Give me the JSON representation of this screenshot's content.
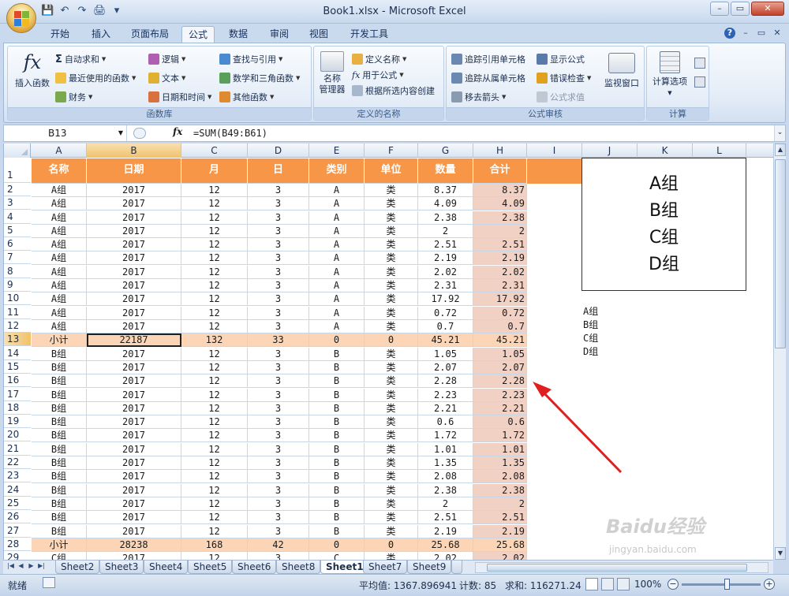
{
  "window": {
    "title": "Book1.xlsx - Microsoft Excel",
    "min": "–",
    "restore": "▭",
    "close": "✕"
  },
  "qat": [
    "💾",
    "↶",
    "↷",
    "🖨",
    "▾"
  ],
  "tabs": [
    "开始",
    "插入",
    "页面布局",
    "公式",
    "数据",
    "审阅",
    "视图",
    "开发工具"
  ],
  "active_tab": "公式",
  "ribbon": {
    "function_library": {
      "label": "函数库",
      "insert_function": "插入函数",
      "autosum": "自动求和",
      "recent": "最近使用的函数",
      "financial": "财务",
      "logical": "逻辑",
      "text": "文本",
      "datetime": "日期和时间",
      "lookup": "查找与引用",
      "math": "数学和三角函数",
      "more": "其他函数"
    },
    "defined_names": {
      "label": "定义的名称",
      "name_manager_1": "名称",
      "name_manager_2": "管理器",
      "define_name": "定义名称",
      "use_in_formula": "用于公式",
      "create_from_selection": "根据所选内容创建"
    },
    "formula_auditing": {
      "label": "公式审核",
      "trace_precedents": "追踪引用单元格",
      "trace_dependents": "追踪从属单元格",
      "remove_arrows": "移去箭头",
      "show_formulas": "显示公式",
      "error_checking": "错误检查",
      "evaluate_formula": "公式求值",
      "watch_window": "监视窗口"
    },
    "calculation": {
      "label": "计算",
      "options": "计算选项"
    }
  },
  "formula_bar": {
    "name_box": "B13",
    "formula": "=SUM(B49:B61)",
    "fx": "fx"
  },
  "columns": [
    "A",
    "B",
    "C",
    "D",
    "E",
    "F",
    "G",
    "H",
    "I",
    "J",
    "K",
    "L"
  ],
  "header": [
    "名称",
    "日期",
    "月",
    "日",
    "类别",
    "单位",
    "数量",
    "合计"
  ],
  "rows": [
    {
      "n": "2",
      "c": [
        "A组",
        "2017",
        "12",
        "3",
        "A",
        "类",
        "8.37",
        "8.37"
      ]
    },
    {
      "n": "3",
      "c": [
        "A组",
        "2017",
        "12",
        "3",
        "A",
        "类",
        "4.09",
        "4.09"
      ]
    },
    {
      "n": "4",
      "c": [
        "A组",
        "2017",
        "12",
        "3",
        "A",
        "类",
        "2.38",
        "2.38"
      ]
    },
    {
      "n": "5",
      "c": [
        "A组",
        "2017",
        "12",
        "3",
        "A",
        "类",
        "2",
        "2"
      ]
    },
    {
      "n": "6",
      "c": [
        "A组",
        "2017",
        "12",
        "3",
        "A",
        "类",
        "2.51",
        "2.51"
      ]
    },
    {
      "n": "7",
      "c": [
        "A组",
        "2017",
        "12",
        "3",
        "A",
        "类",
        "2.19",
        "2.19"
      ]
    },
    {
      "n": "8",
      "c": [
        "A组",
        "2017",
        "12",
        "3",
        "A",
        "类",
        "2.02",
        "2.02"
      ]
    },
    {
      "n": "9",
      "c": [
        "A组",
        "2017",
        "12",
        "3",
        "A",
        "类",
        "2.31",
        "2.31"
      ]
    },
    {
      "n": "10",
      "c": [
        "A组",
        "2017",
        "12",
        "3",
        "A",
        "类",
        "17.92",
        "17.92"
      ]
    },
    {
      "n": "11",
      "c": [
        "A组",
        "2017",
        "12",
        "3",
        "A",
        "类",
        "0.72",
        "0.72"
      ]
    },
    {
      "n": "12",
      "c": [
        "A组",
        "2017",
        "12",
        "3",
        "A",
        "类",
        "0.7",
        "0.7"
      ]
    },
    {
      "n": "13",
      "c": [
        "小计",
        "22187",
        "132",
        "33",
        "0",
        "0",
        "45.21",
        "45.21"
      ],
      "sub": true
    },
    {
      "n": "14",
      "c": [
        "B组",
        "2017",
        "12",
        "3",
        "B",
        "类",
        "1.05",
        "1.05"
      ]
    },
    {
      "n": "15",
      "c": [
        "B组",
        "2017",
        "12",
        "3",
        "B",
        "类",
        "2.07",
        "2.07"
      ]
    },
    {
      "n": "16",
      "c": [
        "B组",
        "2017",
        "12",
        "3",
        "B",
        "类",
        "2.28",
        "2.28"
      ]
    },
    {
      "n": "17",
      "c": [
        "B组",
        "2017",
        "12",
        "3",
        "B",
        "类",
        "2.23",
        "2.23"
      ]
    },
    {
      "n": "18",
      "c": [
        "B组",
        "2017",
        "12",
        "3",
        "B",
        "类",
        "2.21",
        "2.21"
      ]
    },
    {
      "n": "19",
      "c": [
        "B组",
        "2017",
        "12",
        "3",
        "B",
        "类",
        "0.6",
        "0.6"
      ]
    },
    {
      "n": "20",
      "c": [
        "B组",
        "2017",
        "12",
        "3",
        "B",
        "类",
        "1.72",
        "1.72"
      ]
    },
    {
      "n": "21",
      "c": [
        "B组",
        "2017",
        "12",
        "3",
        "B",
        "类",
        "1.01",
        "1.01"
      ]
    },
    {
      "n": "22",
      "c": [
        "B组",
        "2017",
        "12",
        "3",
        "B",
        "类",
        "1.35",
        "1.35"
      ]
    },
    {
      "n": "23",
      "c": [
        "B组",
        "2017",
        "12",
        "3",
        "B",
        "类",
        "2.08",
        "2.08"
      ]
    },
    {
      "n": "24",
      "c": [
        "B组",
        "2017",
        "12",
        "3",
        "B",
        "类",
        "2.38",
        "2.38"
      ]
    },
    {
      "n": "25",
      "c": [
        "B组",
        "2017",
        "12",
        "3",
        "B",
        "类",
        "2",
        "2"
      ]
    },
    {
      "n": "26",
      "c": [
        "B组",
        "2017",
        "12",
        "3",
        "B",
        "类",
        "2.51",
        "2.51"
      ]
    },
    {
      "n": "27",
      "c": [
        "B组",
        "2017",
        "12",
        "3",
        "B",
        "类",
        "2.19",
        "2.19"
      ]
    },
    {
      "n": "28",
      "c": [
        "小计",
        "28238",
        "168",
        "42",
        "0",
        "0",
        "25.68",
        "25.68"
      ],
      "sub": true
    },
    {
      "n": "29",
      "c": [
        "C组",
        "2017",
        "12",
        "3",
        "C",
        "类",
        "2.02",
        "2.02"
      ]
    }
  ],
  "legend_box": [
    "A组",
    "B组",
    "C组",
    "D组"
  ],
  "small_list": [
    "A组",
    "B组",
    "C组",
    "D组"
  ],
  "sheet_tabs": [
    "Sheet2",
    "Sheet3",
    "Sheet4",
    "Sheet5",
    "Sheet6",
    "Sheet8",
    "Sheet1",
    "Sheet7",
    "Sheet9"
  ],
  "active_sheet": "Sheet1",
  "status": {
    "ready": "就绪",
    "average": "平均值: 1367.896941",
    "count": "计数: 85",
    "sum": "求和: 116271.24",
    "zoom": "100%"
  },
  "watermark": {
    "brand": "Baidu经验",
    "url": "jingyan.baidu.com"
  },
  "colors": {
    "header": "#f79646",
    "subtotal": "#fbd5b5",
    "sum_col": "#f2d1c5",
    "arrow": "#e02020"
  }
}
